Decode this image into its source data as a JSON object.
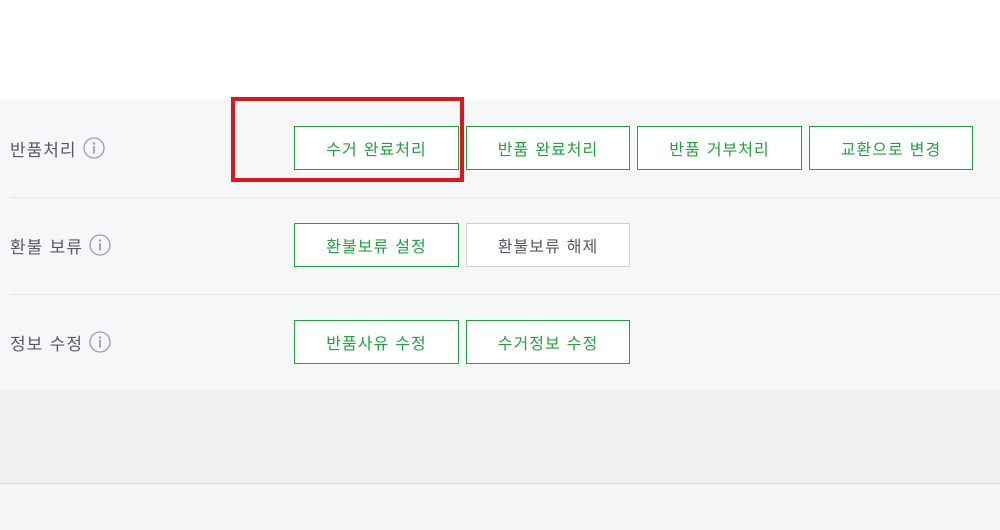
{
  "colors": {
    "accent_green": "#1fa33e",
    "highlight_red": "#e0141d",
    "label_gray": "#555a60"
  },
  "rows": [
    {
      "label": "반품처리",
      "icon": "info-circle-icon",
      "buttons": [
        {
          "label": "수거 완료처리",
          "state": "active"
        },
        {
          "label": "반품 완료처리",
          "state": "active"
        },
        {
          "label": "반품 거부처리",
          "state": "active"
        },
        {
          "label": "교환으로 변경",
          "state": "active"
        }
      ]
    },
    {
      "label": "환불 보류",
      "icon": "info-circle-icon",
      "buttons": [
        {
          "label": "환불보류 설정",
          "state": "active"
        },
        {
          "label": "환불보류 해제",
          "state": "disabled"
        }
      ]
    },
    {
      "label": "정보 수정",
      "icon": "info-circle-icon",
      "buttons": [
        {
          "label": "반품사유 수정",
          "state": "active"
        },
        {
          "label": "수거정보 수정",
          "state": "active"
        }
      ]
    }
  ],
  "annotation": {
    "type": "highlight-box",
    "target": "수거 완료처리"
  }
}
